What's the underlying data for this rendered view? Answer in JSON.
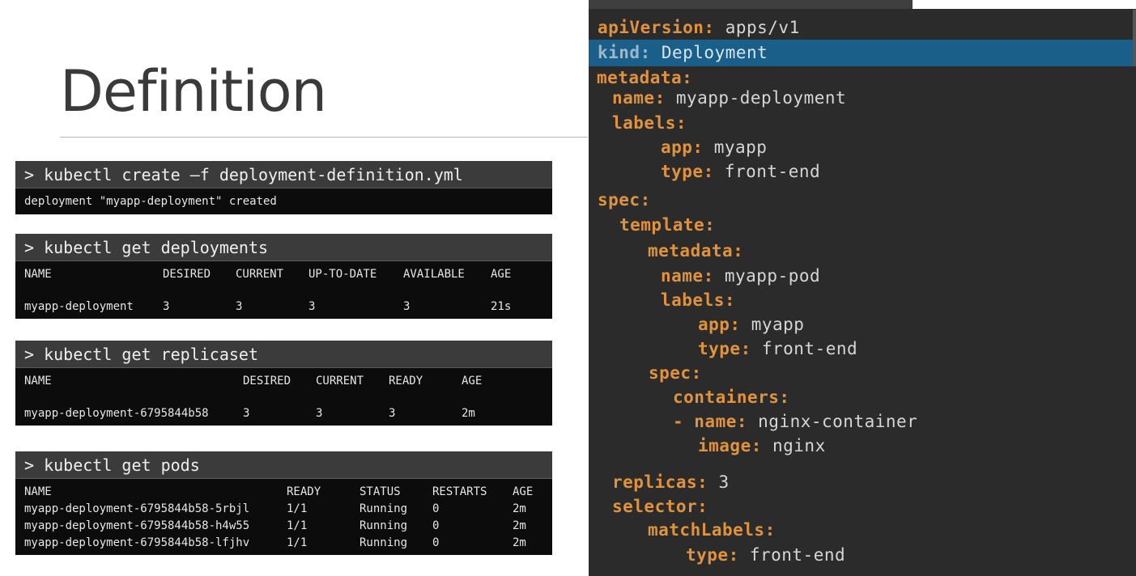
{
  "slide": {
    "title": "Definition"
  },
  "terminals": {
    "create": {
      "command": "> kubectl create –f deployment-definition.yml",
      "output": "deployment \"myapp-deployment\" created"
    },
    "deployments": {
      "command": "> kubectl get deployments",
      "headers": [
        "NAME",
        "DESIRED",
        "CURRENT",
        "UP-TO-DATE",
        "AVAILABLE",
        "AGE"
      ],
      "rows": [
        [
          "myapp-deployment",
          "3",
          "3",
          "3",
          "3",
          "21s"
        ]
      ]
    },
    "replicaset": {
      "command": "> kubectl get replicaset",
      "headers": [
        "NAME",
        "DESIRED",
        "CURRENT",
        "READY",
        "AGE"
      ],
      "rows": [
        [
          "myapp-deployment-6795844b58",
          "3",
          "3",
          "3",
          "2m"
        ]
      ]
    },
    "pods": {
      "command": "> kubectl get pods",
      "headers": [
        "NAME",
        "READY",
        "STATUS",
        "RESTARTS",
        "AGE"
      ],
      "rows": [
        [
          "myapp-deployment-6795844b58-5rbjl",
          "1/1",
          "Running",
          "0",
          "2m"
        ],
        [
          "myapp-deployment-6795844b58-h4w55",
          "1/1",
          "Running",
          "0",
          "2m"
        ],
        [
          "myapp-deployment-6795844b58-lfjhv",
          "1/1",
          "Running",
          "0",
          "2m"
        ]
      ]
    }
  },
  "yaml": {
    "lines": [
      {
        "key": "apiVersion:",
        "value": " apps/v1",
        "indent": 0
      },
      {
        "key": "kind:",
        "value": " Deployment",
        "indent": 0,
        "highlight": true
      },
      {
        "key": "metadata:",
        "value": "",
        "indent": 0
      },
      {
        "key": "name:",
        "value": " myapp-deployment",
        "indent": 1
      },
      {
        "key": "labels:",
        "value": "",
        "indent": 1
      },
      {
        "key": "app:",
        "value": " myapp",
        "indent": 2
      },
      {
        "key": "type:",
        "value": " front-end",
        "indent": 2
      },
      {
        "key": "spec:",
        "value": "",
        "indent": 0
      },
      {
        "key": "template:",
        "value": "",
        "indent": 1
      },
      {
        "key": "metadata:",
        "value": "",
        "indent": 2
      },
      {
        "key": "name:",
        "value": " myapp-pod",
        "indent": 3
      },
      {
        "key": "labels:",
        "value": "",
        "indent": 3
      },
      {
        "key": "app:",
        "value": " myapp",
        "indent": 4
      },
      {
        "key": "type:",
        "value": " front-end",
        "indent": 4
      },
      {
        "key": "spec:",
        "value": "",
        "indent": 2
      },
      {
        "key": "containers:",
        "value": "",
        "indent": 3
      },
      {
        "key": "- name:",
        "value": " nginx-container",
        "indent": 3,
        "dash": true
      },
      {
        "key": "image:",
        "value": " nginx",
        "indent": 4
      },
      {
        "key": "replicas:",
        "value": " 3",
        "indent": 1
      },
      {
        "key": "selector:",
        "value": "",
        "indent": 1
      },
      {
        "key": "matchLabels:",
        "value": "",
        "indent": 2
      },
      {
        "key": "type:",
        "value": " front-end",
        "indent": 3
      }
    ]
  }
}
